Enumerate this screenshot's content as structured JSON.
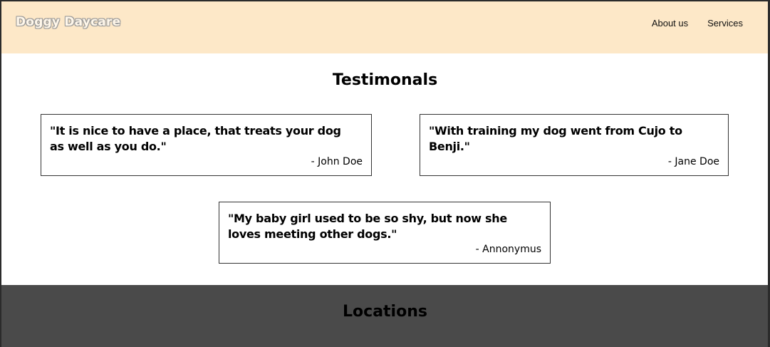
{
  "header": {
    "logo": "Doggy Daycare",
    "nav": [
      {
        "label": "About us"
      },
      {
        "label": "Services"
      }
    ],
    "background": "#fde8c8"
  },
  "testimonials": {
    "title": "Testimonals",
    "items": [
      {
        "quote": "\"It is nice to have a place, that treats your dog as well as you do.\"",
        "author": "- John Doe"
      },
      {
        "quote": "\"With training my dog went from Cujo to Benji.\"",
        "author": "- Jane Doe"
      },
      {
        "quote": "\"My baby girl used to be so shy, but now she loves meeting other dogs.\"",
        "author": "- Annonymus"
      }
    ]
  },
  "locations": {
    "title": "Locations",
    "background": "#4a4a4a"
  }
}
